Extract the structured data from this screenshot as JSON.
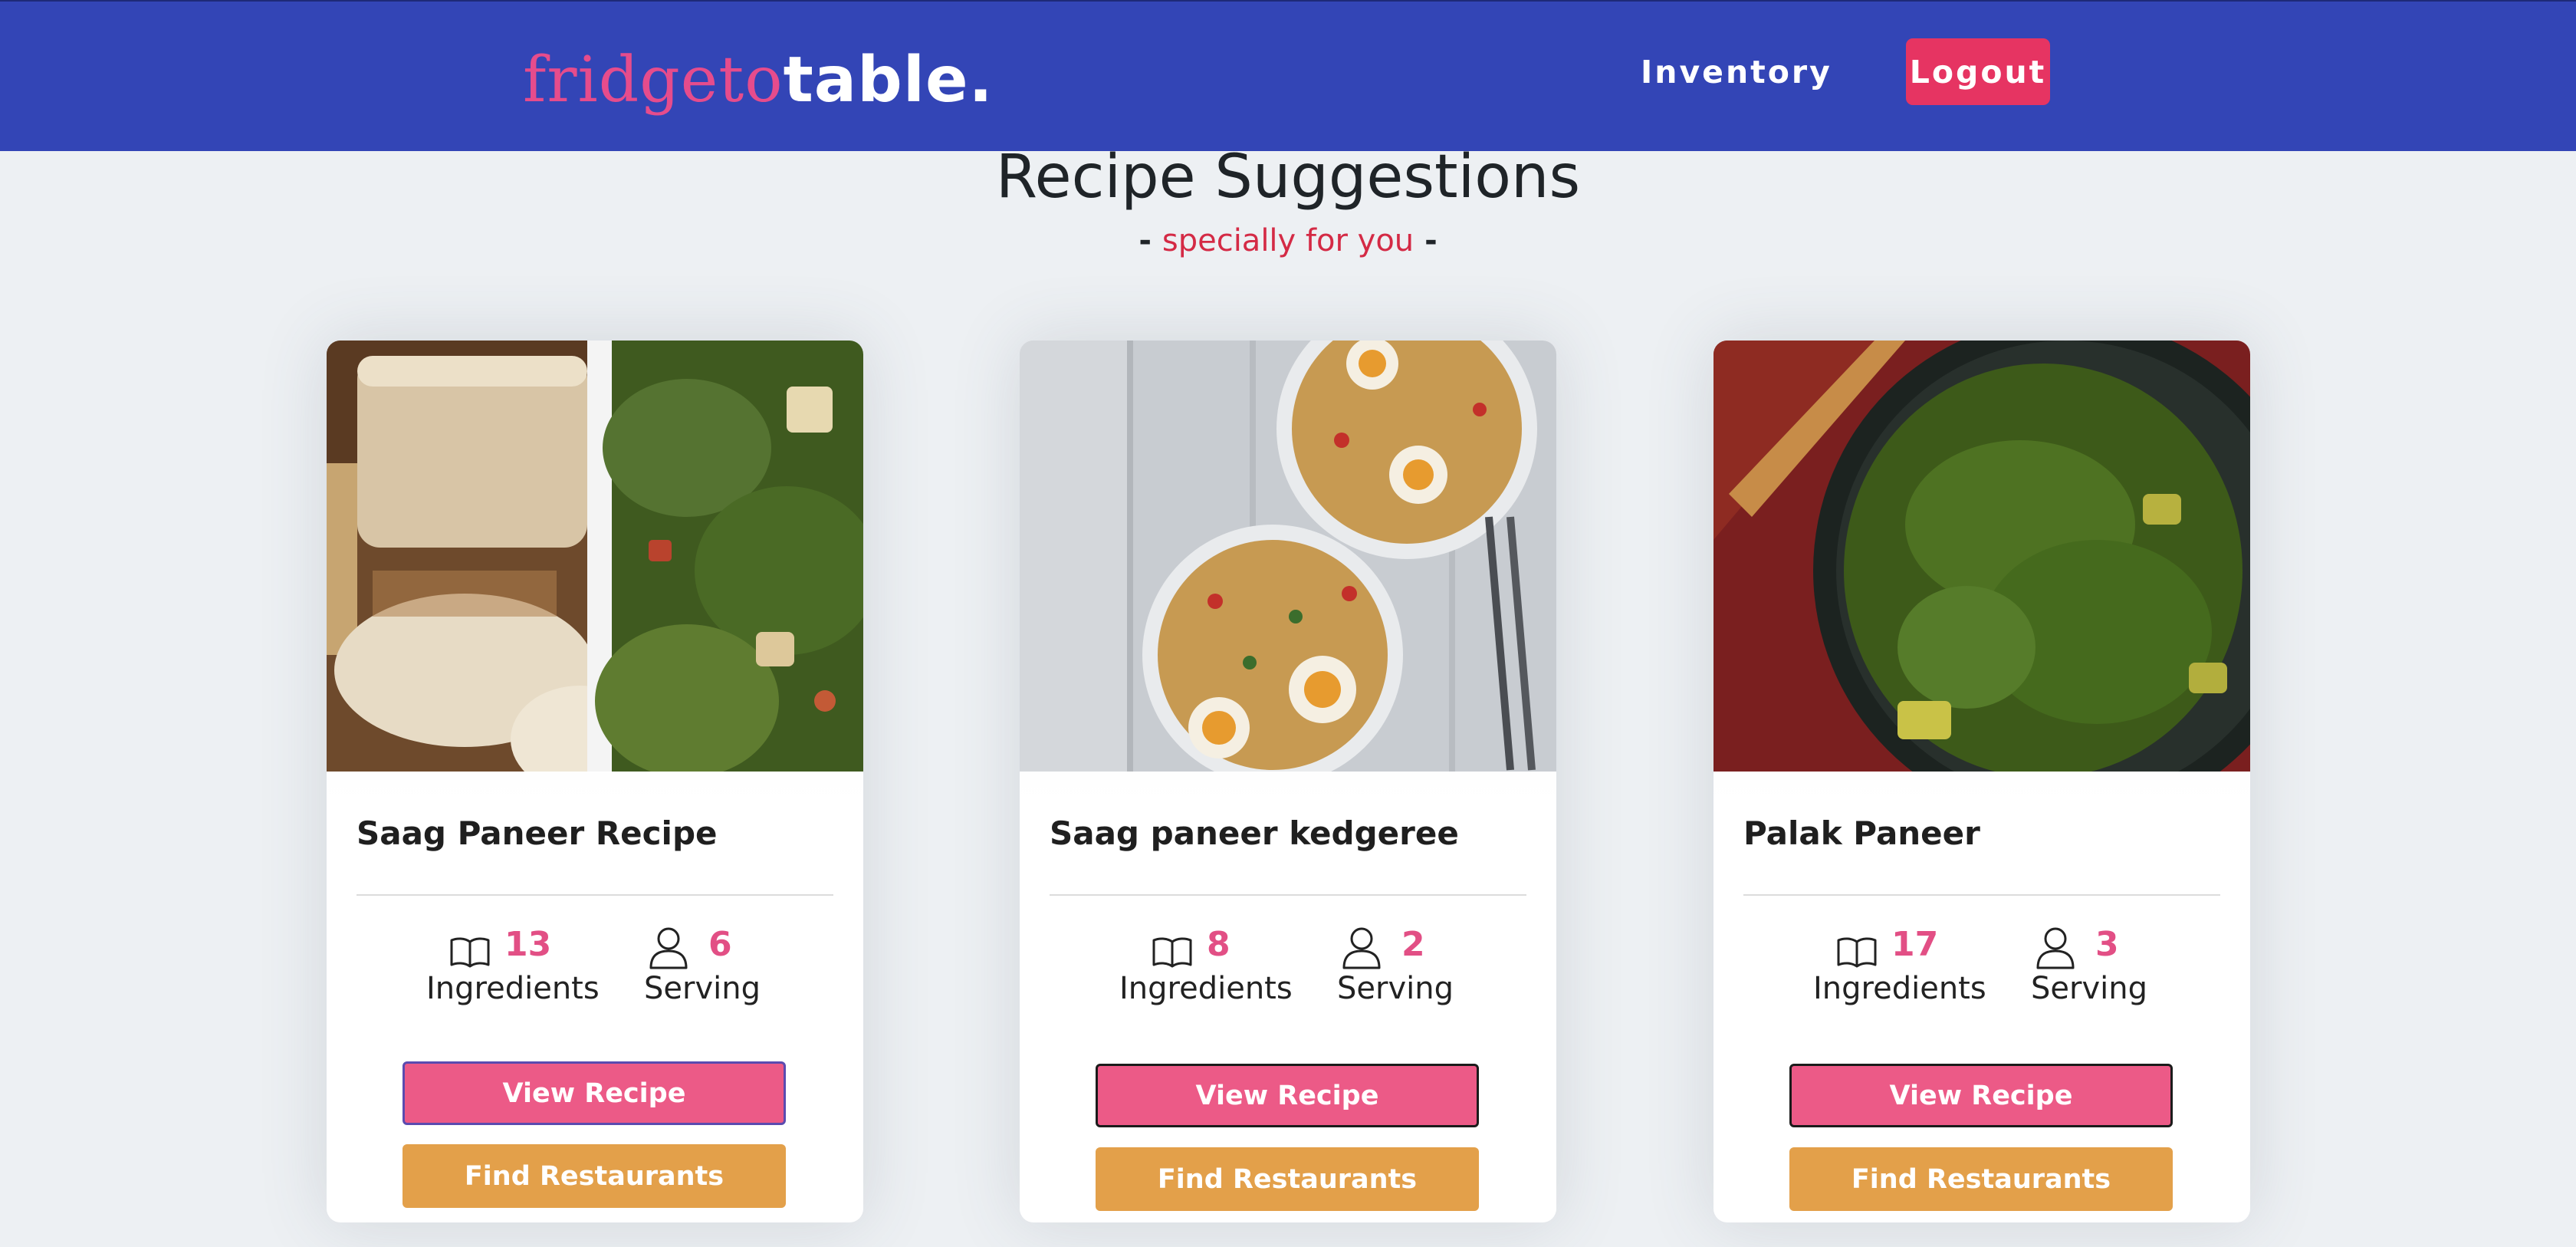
{
  "brand": {
    "logo_part1": "fridgeto",
    "logo_part2": "table."
  },
  "nav": {
    "inventory": "Inventory",
    "logout": "Logout"
  },
  "header": {
    "title": "Recipe Suggestions",
    "dash_left": "- ",
    "subtitle": "specially for you",
    "dash_right": " -"
  },
  "colors": {
    "navbar": "#3345b6",
    "logout": "#e63462",
    "view_recipe": "#ec5a87",
    "find_restaurants": "#e3a04a",
    "accent_number": "#e24f85"
  },
  "cards": [
    {
      "title": "Saag Paneer Recipe",
      "ingredients": "13",
      "ingredients_label": "Ingredients",
      "serving": "6",
      "serving_label": "Serving",
      "view_label": "View Recipe",
      "find_label": "Find Restaurants",
      "ingredients_icon": "book-icon",
      "serving_icon": "user-icon"
    },
    {
      "title": "Saag paneer kedgeree",
      "ingredients": "8",
      "ingredients_label": "Ingredients",
      "serving": "2",
      "serving_label": "Serving",
      "view_label": "View Recipe",
      "find_label": "Find Restaurants",
      "ingredients_icon": "book-icon",
      "serving_icon": "user-icon"
    },
    {
      "title": "Palak Paneer",
      "ingredients": "17",
      "ingredients_label": "Ingredients",
      "serving": "3",
      "serving_label": "Serving",
      "view_label": "View Recipe",
      "find_label": "Find Restaurants",
      "ingredients_icon": "book-icon",
      "serving_icon": "user-icon"
    }
  ]
}
